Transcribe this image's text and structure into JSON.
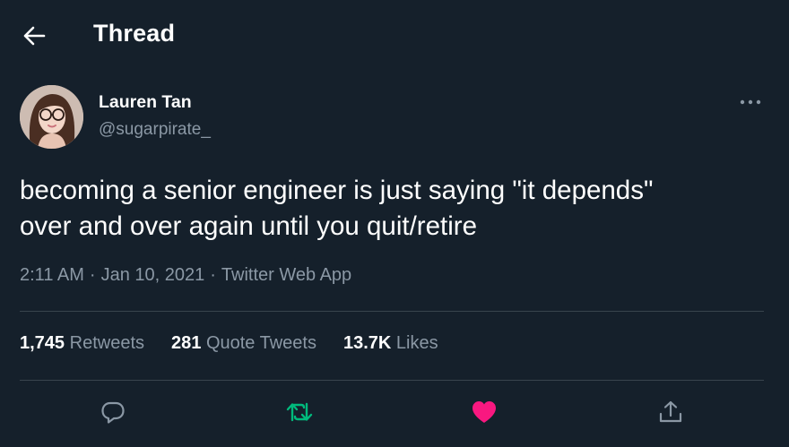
{
  "header": {
    "title": "Thread",
    "back_icon": "arrow-left-icon"
  },
  "author": {
    "name": "Lauren Tan",
    "handle": "@sugarpirate_",
    "avatar_icon": "avatar"
  },
  "tweet": {
    "text": "becoming a senior engineer is just saying \"it depends\"\nover and over again until you quit/retire",
    "time": "2:11 AM",
    "date": "Jan 10, 2021",
    "source": "Twitter Web App",
    "separator": "·"
  },
  "stats": {
    "retweets_count": "1,745",
    "retweets_label": "Retweets",
    "quotes_count": "281",
    "quotes_label": "Quote Tweets",
    "likes_count": "13.7K",
    "likes_label": "Likes"
  },
  "actions": {
    "reply_icon": "reply-icon",
    "retweet_icon": "retweet-icon",
    "like_icon": "heart-icon",
    "share_icon": "share-icon",
    "liked": true,
    "retweeted": true
  },
  "colors": {
    "background": "#15202b",
    "text_primary": "#ffffff",
    "text_secondary": "#8b98a5",
    "divider": "#38444d",
    "retweet_green": "#00ba7c",
    "like_pink": "#f91880"
  }
}
